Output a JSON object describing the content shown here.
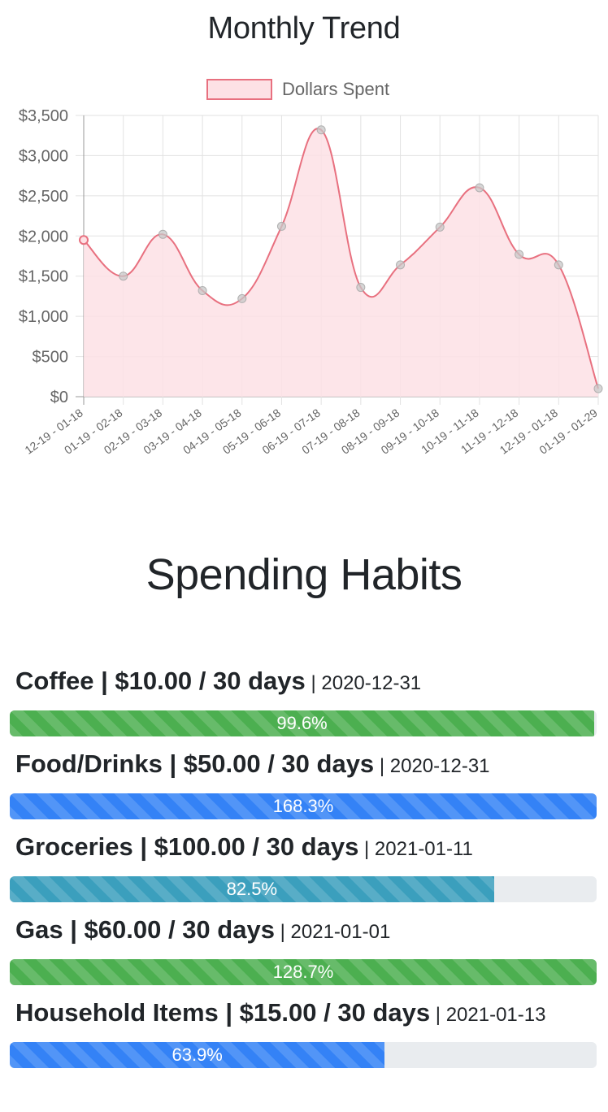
{
  "monthly_trend": {
    "title": "Monthly Trend"
  },
  "chart_data": {
    "type": "line",
    "categories": [
      "12-19 - 01-18",
      "01-19 - 02-18",
      "02-19 - 03-18",
      "03-19 - 04-18",
      "04-19 - 05-18",
      "05-19 - 06-18",
      "06-19 - 07-18",
      "07-19 - 08-18",
      "08-19 - 09-18",
      "09-19 - 10-18",
      "10-19 - 11-18",
      "11-19 - 12-18",
      "12-19 - 01-18",
      "01-19 - 01-29"
    ],
    "series": [
      {
        "name": "Dollars Spent",
        "values": [
          1950,
          1500,
          2020,
          1320,
          1220,
          2120,
          3320,
          1360,
          1640,
          2110,
          2600,
          1770,
          1640,
          100
        ],
        "line_color": "#e8707f",
        "fill_color": "#fde1e5"
      }
    ],
    "yticks": [
      "$0",
      "$500",
      "$1,000",
      "$1,500",
      "$2,000",
      "$2,500",
      "$3,000",
      "$3,500"
    ],
    "ylim": [
      0,
      3500
    ],
    "grid": true,
    "legend": "top"
  },
  "spending_habits": {
    "title": "Spending Habits",
    "items": [
      {
        "name": "Coffee",
        "amount": "$10.00",
        "period": "30 days",
        "date": "2020-12-31",
        "percent_label": "99.6%",
        "fill_percent": 99.6,
        "color": "#4caf50"
      },
      {
        "name": "Food/Drinks",
        "amount": "$50.00",
        "period": "30 days",
        "date": "2020-12-31",
        "percent_label": "168.3%",
        "fill_percent": 100,
        "color": "#3482f6"
      },
      {
        "name": "Groceries",
        "amount": "$100.00",
        "period": "30 days",
        "date": "2021-01-11",
        "percent_label": "82.5%",
        "fill_percent": 82.5,
        "color": "#3b9fbd"
      },
      {
        "name": "Gas",
        "amount": "$60.00",
        "period": "30 days",
        "date": "2021-01-01",
        "percent_label": "128.7%",
        "fill_percent": 100,
        "color": "#4caf50"
      },
      {
        "name": "Household Items",
        "amount": "$15.00",
        "period": "30 days",
        "date": "2021-01-13",
        "percent_label": "63.9%",
        "fill_percent": 63.9,
        "color": "#3482f6"
      }
    ]
  }
}
